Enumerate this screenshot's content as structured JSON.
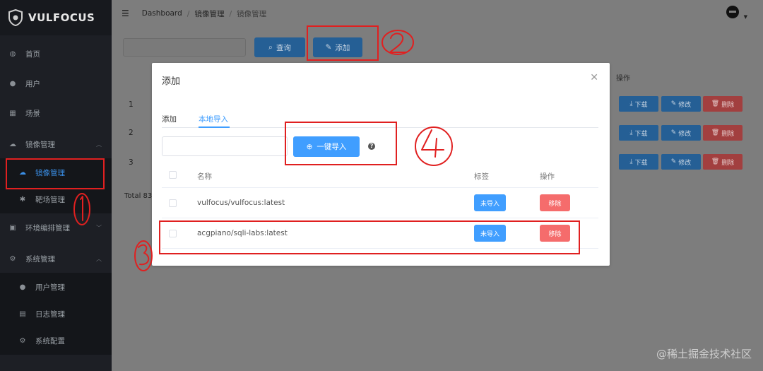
{
  "sidebar": {
    "logo": "VULFOCUS",
    "items": [
      {
        "label": "首页",
        "icon": "dashboard-icon"
      },
      {
        "label": "用户",
        "icon": "user-icon"
      },
      {
        "label": "场景",
        "icon": "grid-icon"
      },
      {
        "label": "镜像管理",
        "icon": "cloud-icon"
      },
      {
        "label": "镜像管理",
        "icon": "cloud-icon"
      },
      {
        "label": "靶场管理",
        "icon": "bug-icon"
      },
      {
        "label": "环境编排管理",
        "icon": "layout-icon"
      },
      {
        "label": "系统管理",
        "icon": "gear-icon"
      },
      {
        "label": "用户管理",
        "icon": "user-icon"
      },
      {
        "label": "日志管理",
        "icon": "document-icon"
      },
      {
        "label": "系统配置",
        "icon": "gear-icon"
      }
    ]
  },
  "breadcrumb": {
    "items": [
      "Dashboard",
      "镜像管理",
      "镜像管理"
    ]
  },
  "toolbar": {
    "query_label": "查询",
    "add_label": "添加"
  },
  "background_table": {
    "operation_header": "操作",
    "rows": [
      "1",
      "2",
      "3"
    ],
    "download_label": "下载",
    "edit_label": "修改",
    "delete_label": "删除",
    "total_text": "Total 83"
  },
  "modal": {
    "title": "添加",
    "tabs": [
      "添加",
      "本地导入"
    ],
    "active_tab": "本地导入",
    "import_button": "一键导入",
    "headers": {
      "name": "名称",
      "tag": "标签",
      "operation": "操作"
    },
    "rows": [
      {
        "name": "vulfocus/vulfocus:latest",
        "tag": "未导入",
        "action": "移除"
      },
      {
        "name": "acgpiano/sqli-labs:latest",
        "tag": "未导入",
        "action": "移除"
      }
    ]
  },
  "annotations": [
    "1",
    "2",
    "3",
    "4"
  ],
  "watermark": "@稀土掘金技术社区",
  "colors": {
    "primary": "#409eff",
    "danger": "#f56c6c",
    "annotation": "#e02020",
    "sidebar_bg": "#1d1f25"
  }
}
